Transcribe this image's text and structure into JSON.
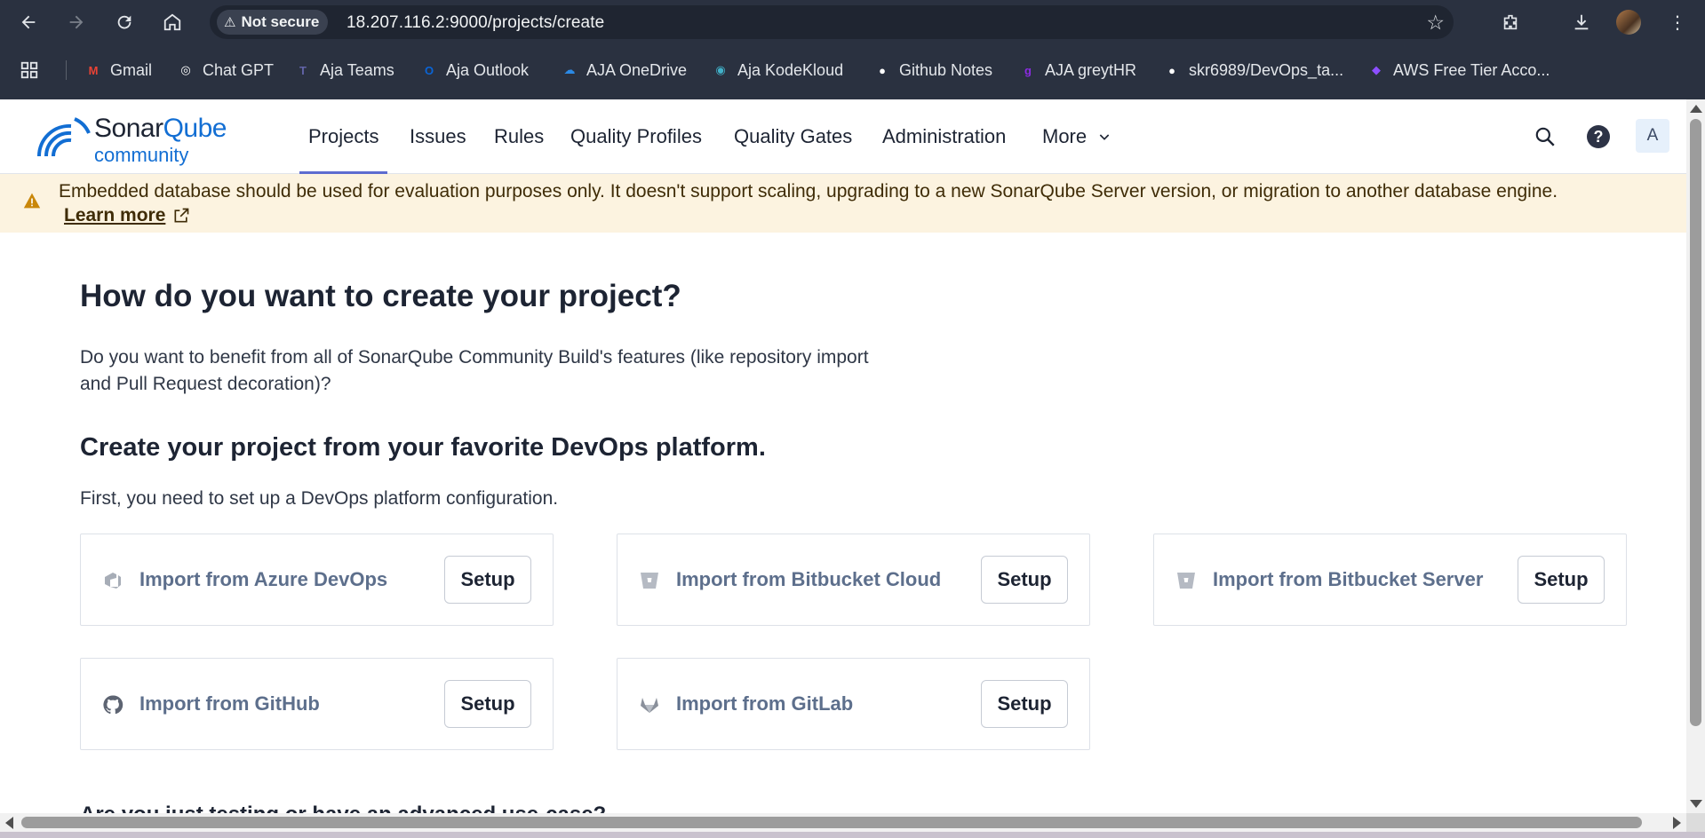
{
  "browser": {
    "security_label": "Not secure",
    "url": "18.207.116.2:9000/projects/create",
    "bookmarks": [
      {
        "label": "Gmail",
        "icon": "gmail-icon",
        "color": "#ea4335"
      },
      {
        "label": "Chat GPT",
        "icon": "chatgpt-icon",
        "color": "#ffffff"
      },
      {
        "label": "Aja Teams",
        "icon": "teams-icon",
        "color": "#6264a7"
      },
      {
        "label": "Aja Outlook",
        "icon": "outlook-icon",
        "color": "#0a64d6"
      },
      {
        "label": "AJA OneDrive",
        "icon": "onedrive-icon",
        "color": "#2b8ae6"
      },
      {
        "label": "Aja KodeKloud",
        "icon": "kodekloud-icon",
        "color": "#41b0c8"
      },
      {
        "label": "Github Notes",
        "icon": "github-icon",
        "color": "#ffffff"
      },
      {
        "label": "AJA greytHR",
        "icon": "greythr-icon",
        "color": "#8a2be2"
      },
      {
        "label": "skr6989/DevOps_ta...",
        "icon": "github-icon",
        "color": "#ffffff"
      },
      {
        "label": "AWS Free Tier Acco...",
        "icon": "aws-icon",
        "color": "#8c4fff"
      }
    ]
  },
  "header": {
    "logo_word1": "Sonar",
    "logo_word2": "Qube",
    "logo_sub": "community",
    "nav": [
      {
        "label": "Projects",
        "active": true
      },
      {
        "label": "Issues"
      },
      {
        "label": "Rules"
      },
      {
        "label": "Quality Profiles"
      },
      {
        "label": "Quality Gates"
      },
      {
        "label": "Administration"
      },
      {
        "label": "More"
      }
    ],
    "user_initial": "A"
  },
  "banner": {
    "message": "Embedded database should be used for evaluation purposes only. It doesn't support scaling, upgrading to a new SonarQube Server version, or migration to another database engine.",
    "link_label": "Learn more",
    "color": "#fcf3e0"
  },
  "main": {
    "title": "How do you want to create your project?",
    "intro_line1": "Do you want to benefit from all of SonarQube Community Build's features (like repository import",
    "intro_line2": "and Pull Request decoration)?",
    "devops_title": "Create your project from your favorite DevOps platform.",
    "devops_sub": "First, you need to set up a DevOps platform configuration.",
    "platforms": [
      {
        "label": "Import from Azure DevOps",
        "button": "Setup",
        "icon": "azure-devops-icon"
      },
      {
        "label": "Import from Bitbucket Cloud",
        "button": "Setup",
        "icon": "bitbucket-icon"
      },
      {
        "label": "Import from Bitbucket Server",
        "button": "Setup",
        "icon": "bitbucket-icon"
      },
      {
        "label": "Import from GitHub",
        "button": "Setup",
        "icon": "github-icon"
      },
      {
        "label": "Import from GitLab",
        "button": "Setup",
        "icon": "gitlab-icon"
      }
    ],
    "cut_off_text": "Are you just testing or have an advanced use-case?"
  }
}
